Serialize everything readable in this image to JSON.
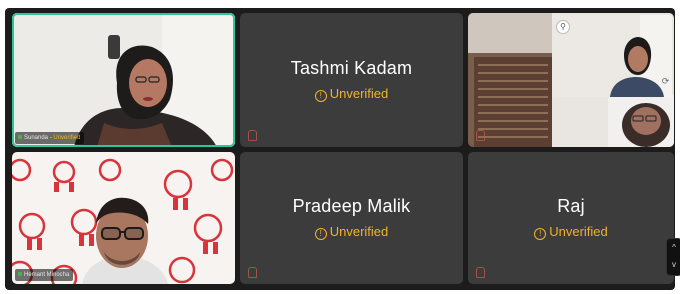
{
  "tiles": [
    {
      "id": "sunanda",
      "tag_name": "Sunanda",
      "tag_status": "Unverified",
      "icon": "person-video"
    },
    {
      "id": "tashmi",
      "name": "Tashmi Kadam",
      "status": "Unverified",
      "icon": "warning-icon"
    },
    {
      "id": "room",
      "icon": "pin-icon"
    },
    {
      "id": "hemant",
      "tag_name": "Hemant Minocha",
      "icon": "person-video"
    },
    {
      "id": "pradeep",
      "name": "Pradeep Malik",
      "status": "Unverified",
      "icon": "warning-icon"
    },
    {
      "id": "raj",
      "name": "Raj",
      "status": "Unverified",
      "icon": "warning-icon"
    }
  ],
  "side_panel": {
    "up": "^",
    "down": "v"
  },
  "colors": {
    "accent": "#2fc59a",
    "warning": "#f0b429",
    "tile_bg": "#3c3c3c"
  }
}
